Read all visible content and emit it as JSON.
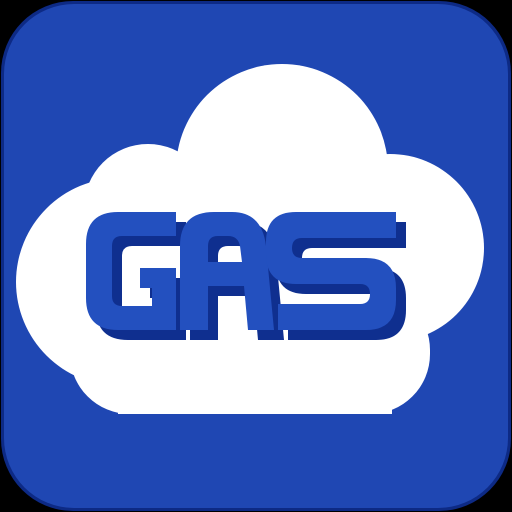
{
  "app_icon": {
    "logo_text": "GAS",
    "icon_name": "cloud-gas-logo-icon",
    "colors": {
      "tile": "#1f47b3",
      "tile_edge": "#0d2a85",
      "cloud": "#ffffff",
      "letters": "#2350bf",
      "letters_depth": "#0f2f8f",
      "background": "#000000"
    }
  }
}
